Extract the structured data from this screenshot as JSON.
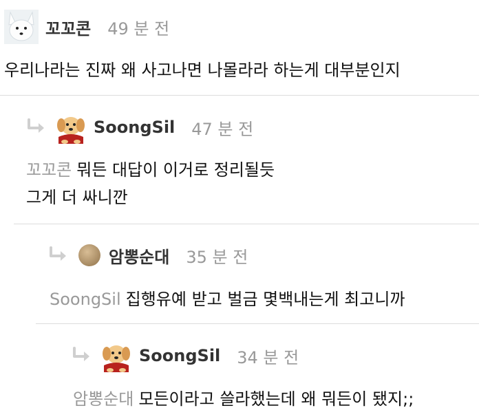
{
  "comments": [
    {
      "nick": "꼬꼬콘",
      "time": "49 분 전",
      "avatar": "fox-avatar",
      "mention": "",
      "lines": [
        "우리나라는 진짜 왜 사고나면 나몰라라 하는게 대부분인지"
      ]
    },
    {
      "nick": "SoongSil",
      "time": "47 분 전",
      "avatar": "dog-avatar",
      "mention": "꼬꼬콘",
      "lines": [
        "뭐든 대답이 이거로 정리될듯",
        "그게 더 싸니깐"
      ]
    },
    {
      "nick": "암뽕순대",
      "time": "35 분 전",
      "avatar": "default-avatar",
      "mention": "SoongSil",
      "lines": [
        "집행유예 받고 벌금 몇백내는게 최고니까"
      ]
    },
    {
      "nick": "SoongSil",
      "time": "34 분 전",
      "avatar": "dog-avatar",
      "mention": "암뽕순대",
      "lines": [
        "모든이라고 쓸라했는데 왜 뭐든이 됐지;;"
      ]
    }
  ],
  "colors": {
    "nick": "#333333",
    "time": "#999999",
    "mention": "#999999",
    "divider": "#dcdcdc"
  }
}
